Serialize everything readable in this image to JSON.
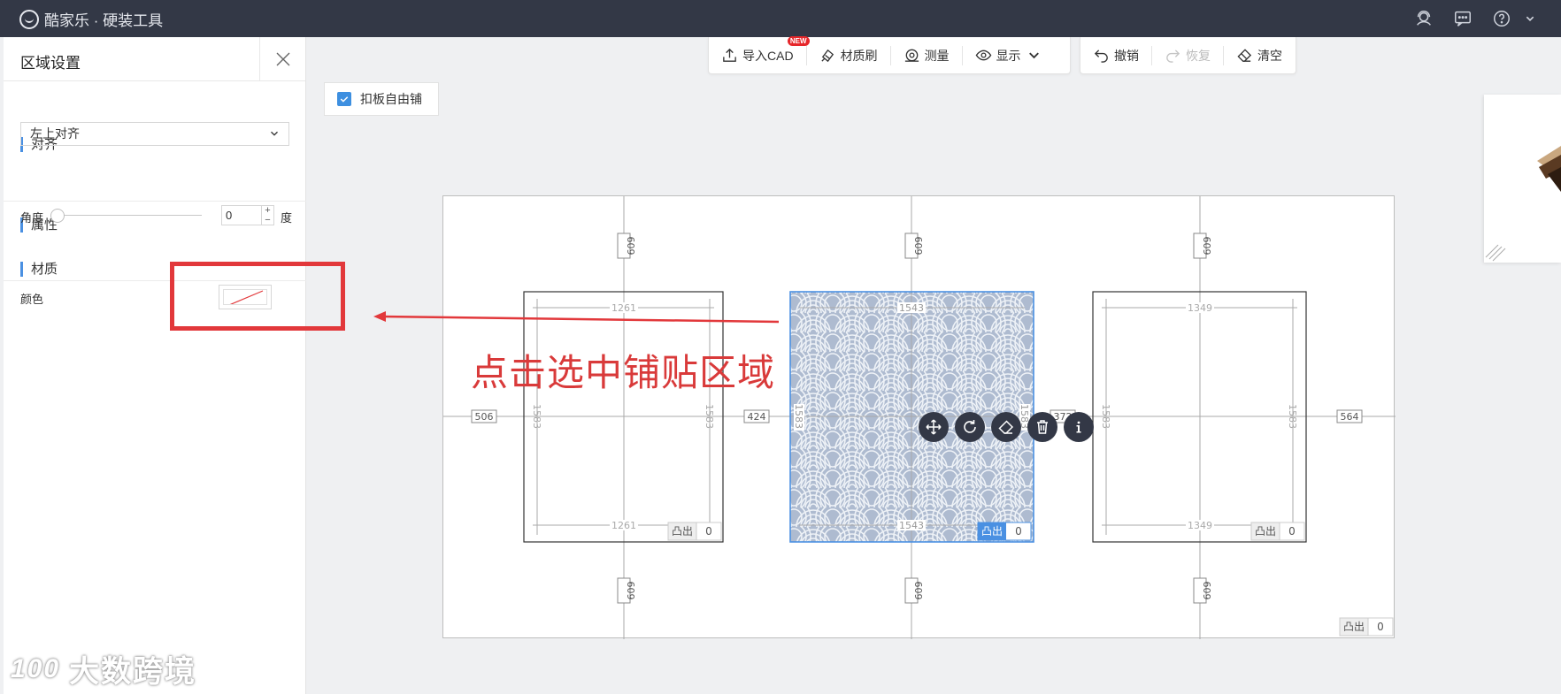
{
  "app": {
    "title": "酷家乐 · 硬装工具"
  },
  "panel": {
    "title": "区域设置",
    "align": {
      "heading": "对齐",
      "selected": "左上对齐"
    },
    "attributes": {
      "heading": "属性",
      "angle_label": "角度",
      "angle_value": "0",
      "plus": "+",
      "minus": "−",
      "unit": "度"
    },
    "material": {
      "heading": "材质",
      "color_label": "颜色"
    }
  },
  "toolbar": {
    "import_cad": "导入CAD",
    "new_badge": "NEW",
    "material_brush": "材质刷",
    "measure": "测量",
    "display": "显示",
    "undo": "撤销",
    "redo": "恢复",
    "clear": "清空"
  },
  "option": {
    "free_tile_label": "扣板自由铺",
    "free_tile_checked": true
  },
  "annotation": {
    "text": "点击选中铺贴区域"
  },
  "canvas": {
    "regions": [
      {
        "top_width": "1261",
        "bottom_width": "1261",
        "left_height": "1583",
        "right_height": "1583",
        "protrude_label": "凸出",
        "protrude_value": "0",
        "selected": false
      },
      {
        "top_width": "1543",
        "bottom_width": "1543",
        "left_height": "1583",
        "right_height": "1583",
        "protrude_label": "凸出",
        "protrude_value": "0",
        "selected": true
      },
      {
        "top_width": "1349",
        "bottom_width": "1349",
        "left_height": "1583",
        "right_height": "1583",
        "protrude_label": "凸出",
        "protrude_value": "0",
        "selected": false
      }
    ],
    "gaps": {
      "top": "609",
      "bottom": "609",
      "left_margin": "506",
      "between_1_2": "424",
      "between_2_3": "372",
      "right_margin": "564"
    },
    "outer_protrude_label": "凸出",
    "outer_protrude_value": "0"
  },
  "watermark": {
    "text": "大数跨境",
    "logo_text": "100"
  },
  "colors": {
    "accent": "#3d8fe0",
    "topbar": "#333846",
    "annotation_red": "#e2383b"
  }
}
